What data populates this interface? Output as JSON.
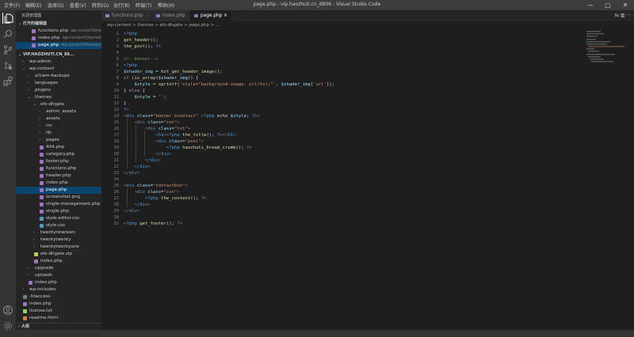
{
  "menu": [
    "文件(F)",
    "编辑(E)",
    "选择(S)",
    "查看(V)",
    "转到(G)",
    "运行(R)",
    "终端(T)",
    "帮助(H)"
  ],
  "window_title": "page.php - vip.haozhuti.cn_8806 - Visual Studio Code",
  "window_controls": {
    "minimize": "—",
    "maximize": "□",
    "close": "✕"
  },
  "sidebar": {
    "header": "资源管理器",
    "open_editors_title": "打开的编辑器",
    "open_editors": [
      {
        "label": "functions.php",
        "path": "wp-content\\themes\\efs..."
      },
      {
        "label": "index.php",
        "path": "wp-content\\themes\\efs..."
      },
      {
        "label": "page.php",
        "path": "wp-content\\themes\\efs..."
      }
    ],
    "workspace_title": "VIP.HAOZHUTI.CN_88...",
    "tree": [
      {
        "label": "wp-admin",
        "type": "folder",
        "depth": 0,
        "open": false
      },
      {
        "label": "wp-content",
        "type": "folder",
        "depth": 0,
        "open": true
      },
      {
        "label": "ai1wm-backups",
        "type": "folder",
        "depth": 1,
        "open": false
      },
      {
        "label": "languages",
        "type": "folder",
        "depth": 1,
        "open": false
      },
      {
        "label": "plugins",
        "type": "folder",
        "depth": 1,
        "open": false
      },
      {
        "label": "themes",
        "type": "folder",
        "depth": 1,
        "open": true
      },
      {
        "label": "efs-dhgate",
        "type": "folder",
        "depth": 2,
        "open": true
      },
      {
        "label": "admin_assets",
        "type": "folder",
        "depth": 3,
        "open": false
      },
      {
        "label": "assets",
        "type": "folder",
        "depth": 3,
        "open": false
      },
      {
        "label": "inc",
        "type": "folder",
        "depth": 3,
        "open": false
      },
      {
        "label": "lib",
        "type": "folder",
        "depth": 3,
        "open": false
      },
      {
        "label": "pages",
        "type": "folder",
        "depth": 3,
        "open": false
      },
      {
        "label": "404.php",
        "type": "php",
        "depth": 3
      },
      {
        "label": "category.php",
        "type": "php",
        "depth": 3
      },
      {
        "label": "footer.php",
        "type": "php",
        "depth": 3
      },
      {
        "label": "functions.php",
        "type": "php",
        "depth": 3
      },
      {
        "label": "header.php",
        "type": "php",
        "depth": 3
      },
      {
        "label": "index.php",
        "type": "php",
        "depth": 3
      },
      {
        "label": "page.php",
        "type": "php",
        "depth": 3,
        "selected": true
      },
      {
        "label": "screenshot.png",
        "type": "png",
        "depth": 3
      },
      {
        "label": "single-management.php",
        "type": "php",
        "depth": 3
      },
      {
        "label": "single.php",
        "type": "php",
        "depth": 3
      },
      {
        "label": "style-editor.css",
        "type": "css",
        "depth": 3
      },
      {
        "label": "style.css",
        "type": "css",
        "depth": 3
      },
      {
        "label": "twentynineteen",
        "type": "folder",
        "depth": 2,
        "open": false
      },
      {
        "label": "twentytwenty",
        "type": "folder",
        "depth": 2,
        "open": false
      },
      {
        "label": "twentytwentyone",
        "type": "folder",
        "depth": 2,
        "open": false
      },
      {
        "label": "efs-dhgate.zip",
        "type": "zip",
        "depth": 2
      },
      {
        "label": "index.php",
        "type": "php",
        "depth": 2
      },
      {
        "label": "upgrade",
        "type": "folder",
        "depth": 1,
        "open": false
      },
      {
        "label": "uploads",
        "type": "folder",
        "depth": 1,
        "open": false
      },
      {
        "label": "index.php",
        "type": "php",
        "depth": 1
      },
      {
        "label": "wp-includes",
        "type": "folder",
        "depth": 0,
        "open": false
      },
      {
        "label": ".htaccess",
        "type": "gear",
        "depth": 0
      },
      {
        "label": "index.php",
        "type": "php",
        "depth": 0
      },
      {
        "label": "license.txt",
        "type": "txt",
        "depth": 0
      },
      {
        "label": "readme.html",
        "type": "html",
        "depth": 0
      }
    ],
    "outline_title": "大纲"
  },
  "tabs": [
    {
      "label": "functions.php",
      "active": false
    },
    {
      "label": "index.php",
      "active": false
    },
    {
      "label": "page.php",
      "active": true
    }
  ],
  "tab_actions": "⇆  ▥  ···",
  "breadcrumb": "wp-content  >  themes  >  efs-dhgate  >  page.php  >  ...",
  "code_lines": [
    [
      [
        "<?php",
        "#569cd6"
      ]
    ],
    [
      [
        "get_header",
        "#dcdcaa"
      ],
      [
        "();",
        "#d4d4d4"
      ]
    ],
    [
      [
        "the_post",
        "#dcdcaa"
      ],
      [
        "(); ",
        "#d4d4d4"
      ],
      [
        "?>",
        "#569cd6"
      ]
    ],
    [],
    [
      [
        "<!--banner-->",
        "#6a9955"
      ]
    ],
    [
      [
        "<?php",
        "#569cd6"
      ]
    ],
    [
      [
        "$shader_img",
        "#9cdcfe"
      ],
      [
        " = ",
        "#d4d4d4"
      ],
      [
        "hzt_get_header_image",
        "#dcdcaa"
      ],
      [
        "();",
        "#d4d4d4"
      ]
    ],
    [
      [
        "if",
        "#c586c0"
      ],
      [
        " (",
        "#d4d4d4"
      ],
      [
        "is_array",
        "#dcdcaa"
      ],
      [
        "(",
        "#d4d4d4"
      ],
      [
        "$shader_img",
        "#9cdcfe"
      ],
      [
        ")) {",
        "#d4d4d4"
      ]
    ],
    [
      [
        "    $style",
        "#9cdcfe"
      ],
      [
        " = ",
        "#d4d4d4"
      ],
      [
        "sprintf",
        "#dcdcaa"
      ],
      [
        "(",
        "#d4d4d4"
      ],
      [
        "'style=\"background-image: url(%s);\"'",
        "#ce9178"
      ],
      [
        ", ",
        "#d4d4d4"
      ],
      [
        "$shader_img",
        "#9cdcfe"
      ],
      [
        "[",
        "#d4d4d4"
      ],
      [
        "'url'",
        "#ce9178"
      ],
      [
        "]);",
        "#d4d4d4"
      ]
    ],
    [
      [
        "} ",
        "#d4d4d4"
      ],
      [
        "else",
        "#c586c0"
      ],
      [
        " {",
        "#d4d4d4"
      ]
    ],
    [
      [
        "    $style",
        "#9cdcfe"
      ],
      [
        " = ",
        "#d4d4d4"
      ],
      [
        "''",
        "#ce9178"
      ],
      [
        ";",
        "#d4d4d4"
      ]
    ],
    [
      [
        "}",
        "#d4d4d4"
      ]
    ],
    [
      [
        "?>",
        "#569cd6"
      ]
    ],
    [
      [
        "<",
        "#808080"
      ],
      [
        "div",
        "#569cd6"
      ],
      [
        " class",
        "#9cdcfe"
      ],
      [
        "=",
        "#d4d4d4"
      ],
      [
        "\"banner bcontact\"",
        "#ce9178"
      ],
      [
        " ",
        "#d4d4d4"
      ],
      [
        "<?php",
        "#569cd6"
      ],
      [
        " echo ",
        "#d4d4d4"
      ],
      [
        "$style",
        "#9cdcfe"
      ],
      [
        "; ",
        "#d4d4d4"
      ],
      [
        "?>",
        "#569cd6"
      ],
      [
        ">",
        "#808080"
      ]
    ],
    [
      [
        "    <",
        "#808080"
      ],
      [
        "div",
        "#569cd6"
      ],
      [
        " class",
        "#9cdcfe"
      ],
      [
        "=",
        "#d4d4d4"
      ],
      [
        "\"con\"",
        "#ce9178"
      ],
      [
        ">",
        "#808080"
      ]
    ],
    [
      [
        "        <",
        "#808080"
      ],
      [
        "div",
        "#569cd6"
      ],
      [
        " class",
        "#9cdcfe"
      ],
      [
        "=",
        "#d4d4d4"
      ],
      [
        "\"txt\"",
        "#ce9178"
      ],
      [
        ">",
        "#808080"
      ]
    ],
    [
      [
        "            <",
        "#808080"
      ],
      [
        "h1",
        "#569cd6"
      ],
      [
        ">",
        "#808080"
      ],
      [
        "<?php",
        "#569cd6"
      ],
      [
        " the_title",
        "#dcdcaa"
      ],
      [
        "(); ",
        "#d4d4d4"
      ],
      [
        "?>",
        "#569cd6"
      ],
      [
        "</",
        "#808080"
      ],
      [
        "h1",
        "#569cd6"
      ],
      [
        ">",
        "#808080"
      ]
    ],
    [
      [
        "            <",
        "#808080"
      ],
      [
        "div",
        "#569cd6"
      ],
      [
        " class",
        "#9cdcfe"
      ],
      [
        "=",
        "#d4d4d4"
      ],
      [
        "\"posi\"",
        "#ce9178"
      ],
      [
        ">",
        "#808080"
      ]
    ],
    [
      [
        "                <?php",
        "#569cd6"
      ],
      [
        " haozhuti_bread_crumb",
        "#dcdcaa"
      ],
      [
        "(); ",
        "#d4d4d4"
      ],
      [
        "?>",
        "#569cd6"
      ]
    ],
    [
      [
        "            </",
        "#808080"
      ],
      [
        "div",
        "#569cd6"
      ],
      [
        ">",
        "#808080"
      ]
    ],
    [
      [
        "        </",
        "#808080"
      ],
      [
        "div",
        "#569cd6"
      ],
      [
        ">",
        "#808080"
      ]
    ],
    [
      [
        "    </",
        "#808080"
      ],
      [
        "div",
        "#569cd6"
      ],
      [
        ">",
        "#808080"
      ]
    ],
    [
      [
        "</",
        "#808080"
      ],
      [
        "div",
        "#569cd6"
      ],
      [
        ">",
        "#808080"
      ]
    ],
    [],
    [
      [
        "<",
        "#808080"
      ],
      [
        "div",
        "#569cd6"
      ],
      [
        " class",
        "#9cdcfe"
      ],
      [
        "=",
        "#d4d4d4"
      ],
      [
        "\"contactbox\"",
        "#ce9178"
      ],
      [
        ">",
        "#808080"
      ]
    ],
    [
      [
        "    <",
        "#808080"
      ],
      [
        "div",
        "#569cd6"
      ],
      [
        " class",
        "#9cdcfe"
      ],
      [
        "=",
        "#d4d4d4"
      ],
      [
        "\"con\"",
        "#ce9178"
      ],
      [
        ">",
        "#808080"
      ]
    ],
    [
      [
        "        <?php",
        "#569cd6"
      ],
      [
        " the_content",
        "#dcdcaa"
      ],
      [
        "(); ",
        "#d4d4d4"
      ],
      [
        "?>",
        "#569cd6"
      ]
    ],
    [
      [
        "    </",
        "#808080"
      ],
      [
        "div",
        "#569cd6"
      ],
      [
        ">",
        "#808080"
      ]
    ],
    [
      [
        "</",
        "#808080"
      ],
      [
        "div",
        "#569cd6"
      ],
      [
        ">",
        "#808080"
      ]
    ],
    [],
    [
      [
        "<?php",
        "#569cd6"
      ],
      [
        " get_footer",
        "#dcdcaa"
      ],
      [
        "(); ",
        "#d4d4d4"
      ],
      [
        "?>",
        "#569cd6"
      ]
    ]
  ],
  "file_icon_colors": {
    "php": "#a074c4",
    "css": "#519aba",
    "png": "#a074c4",
    "zip": "#cbcb41",
    "txt": "#89e051",
    "html": "#e37933",
    "gear": "#6d8086"
  },
  "accent": "#094771"
}
